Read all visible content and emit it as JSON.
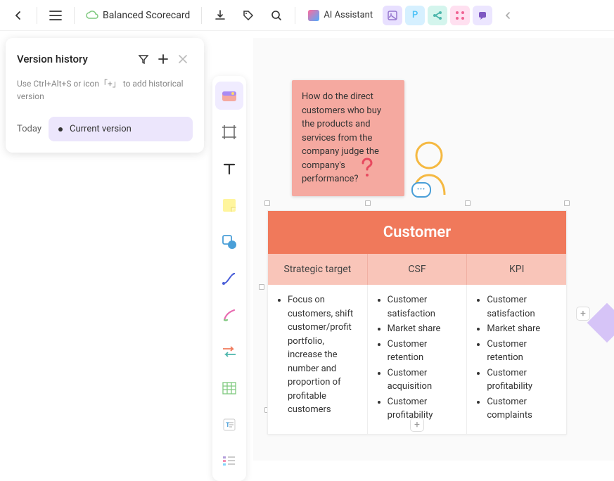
{
  "toolbar": {
    "doc_title": "Balanced Scorecard",
    "ai_label": "AI Assistant",
    "feature_pills": [
      "",
      "P",
      "",
      "",
      ""
    ]
  },
  "version_panel": {
    "title": "Version history",
    "hint": "Use Ctrl+Alt+S or icon「+」 to add historical version",
    "today_label": "Today",
    "current_label": "Current version"
  },
  "canvas": {
    "sticky_note": "How do the direct customers who buy the products and services from the company judge the company's performance?",
    "table": {
      "title": "Customer",
      "headers": [
        "Strategic target",
        "CSF",
        "KPI"
      ],
      "columns": [
        [
          "Focus on customers, shift customer/profit portfolio, increase the number and proportion of profitable customers"
        ],
        [
          "Customer satisfaction",
          "Market share",
          "Customer retention",
          "Customer acquisition",
          "Customer profitability"
        ],
        [
          "Customer satisfaction",
          "Market share",
          "Customer retention",
          "Customer profitability",
          "Customer complaints"
        ]
      ]
    }
  }
}
